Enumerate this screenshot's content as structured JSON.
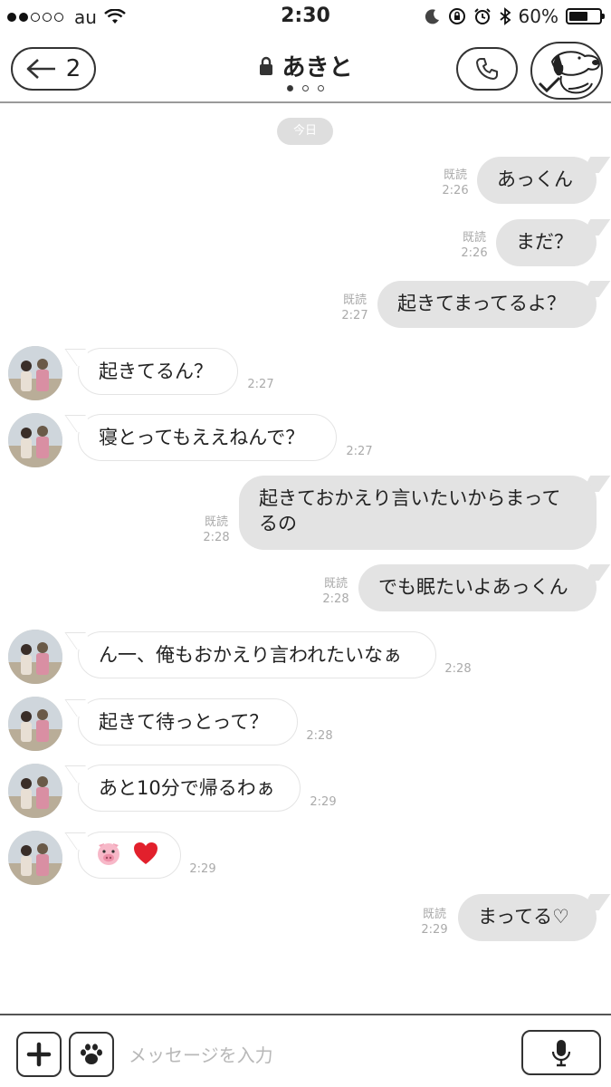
{
  "status_bar": {
    "carrier": "au",
    "time": "2:30",
    "battery": "60%",
    "battery_level": 0.6
  },
  "header": {
    "back_count": "2",
    "title": "あきと",
    "page_count": 3,
    "page_active": 0
  },
  "chat": {
    "date_label": "今日",
    "messages": [
      {
        "side": "out",
        "text": "あっくん",
        "read": "既読",
        "time": "2:26"
      },
      {
        "side": "out",
        "text": "まだ？",
        "read": "既読",
        "time": "2:26"
      },
      {
        "side": "out",
        "text": "起きてまってるよ？",
        "read": "既読",
        "time": "2:27"
      },
      {
        "side": "in",
        "text": "起きてるん？",
        "time": "2:27"
      },
      {
        "side": "in",
        "text": "寝とってもええねんで？",
        "time": "2:27"
      },
      {
        "side": "out",
        "text": "起きておかえり言いたいからまってるの",
        "read": "既読",
        "time": "2:28"
      },
      {
        "side": "out",
        "text": "でも眠たいよあっくん",
        "read": "既読",
        "time": "2:28"
      },
      {
        "side": "in",
        "text": "ん一、俺もおかえり言われたいなぁ",
        "time": "2:28"
      },
      {
        "side": "in",
        "text": "起きて待っとって？",
        "time": "2:28"
      },
      {
        "side": "in",
        "text": "あと10分で帰るわぁ",
        "time": "2:29"
      },
      {
        "side": "in",
        "text": "🐷❤️",
        "time": "2:29"
      },
      {
        "side": "out",
        "text": "まってる♡",
        "read": "既読",
        "time": "2:29"
      }
    ]
  },
  "footer": {
    "input_placeholder": "メッセージを入力"
  }
}
